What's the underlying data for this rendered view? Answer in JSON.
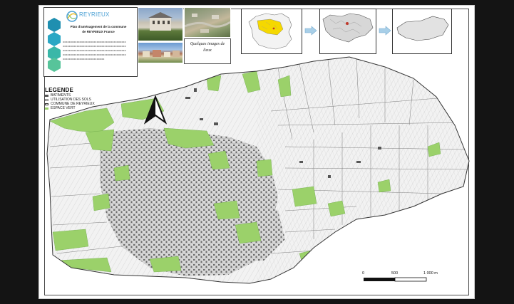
{
  "header": {
    "brand_name": "REYRIEUX",
    "title_line1": "Plan d'aménagement de la commune",
    "title_line2": "de REYRIEUX France",
    "placeholder_lines": [
      "xxxxxxxxxxxxxxxxxxxxxxxxxxxxxxxxxxxxxxxxx",
      "xxxxxxxxxxxxxxxxxxxxxxxxxxxxxxxxxxxxxxxxx",
      "xxxxxxxxxxxxxxxxxxxxxxxxxxxxxxxxxxxxxxxxx",
      "xxxxxxxxxxxxxxxxxxxxxxxxxxxxxxxxxxxxxxxxx",
      "xxxxxxxxxxxxxxxxxxxxxxxxxxx"
    ]
  },
  "photos": {
    "caption_line1": "Quelques images de",
    "caption_line2": "lieux"
  },
  "legend": {
    "title": "LEGENDE",
    "items": [
      {
        "label": "BATIMENTS",
        "color": "#555555"
      },
      {
        "label": "UTILISATION DES SOLS",
        "color": "#e8e8e8"
      },
      {
        "label": "COMMUNE DE REYRIEUX",
        "color": "#f4f4f4"
      },
      {
        "label": "ESPACE VERT",
        "color": "#9bd16a"
      }
    ]
  },
  "scale": {
    "labels": [
      "0",
      "500",
      "1 000 m"
    ]
  },
  "colors": {
    "green_space": "#9bd16a",
    "parcel_fill": "#f2f2f2",
    "parcel_line": "#8a8a8a",
    "building": "#6b6b6b",
    "highlight_region": "#f5d800",
    "inset_arrow": "#a8cfe8"
  }
}
